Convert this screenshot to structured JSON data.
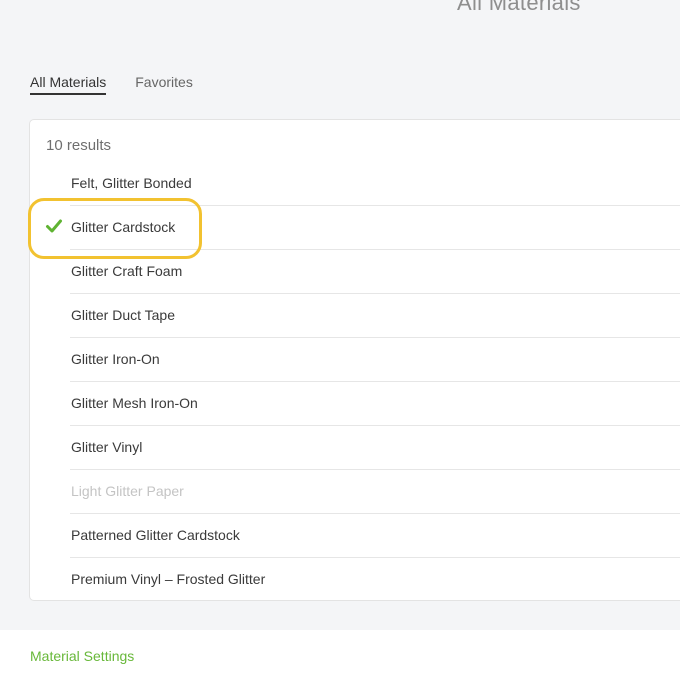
{
  "header": {
    "title": "All Materials"
  },
  "tabs": [
    {
      "label": "All Materials",
      "active": true
    },
    {
      "label": "Favorites",
      "active": false
    }
  ],
  "results": {
    "count_label": "10 results"
  },
  "materials": [
    {
      "label": "Felt, Glitter Bonded",
      "selected": false,
      "disabled": false
    },
    {
      "label": "Glitter Cardstock",
      "selected": true,
      "disabled": false
    },
    {
      "label": "Glitter Craft Foam",
      "selected": false,
      "disabled": false
    },
    {
      "label": "Glitter Duct Tape",
      "selected": false,
      "disabled": false
    },
    {
      "label": "Glitter Iron-On",
      "selected": false,
      "disabled": false
    },
    {
      "label": "Glitter Mesh Iron-On",
      "selected": false,
      "disabled": false
    },
    {
      "label": "Glitter Vinyl",
      "selected": false,
      "disabled": false
    },
    {
      "label": "Light Glitter Paper",
      "selected": false,
      "disabled": true
    },
    {
      "label": "Patterned Glitter Cardstock",
      "selected": false,
      "disabled": false
    },
    {
      "label": "Premium Vinyl – Frosted Glitter",
      "selected": false,
      "disabled": false
    }
  ],
  "footer": {
    "settings_label": "Material Settings"
  },
  "colors": {
    "check": "#5fb332",
    "highlight": "#f2c230",
    "link": "#68b83a"
  },
  "icons": {
    "selected": "checkmark-icon"
  }
}
